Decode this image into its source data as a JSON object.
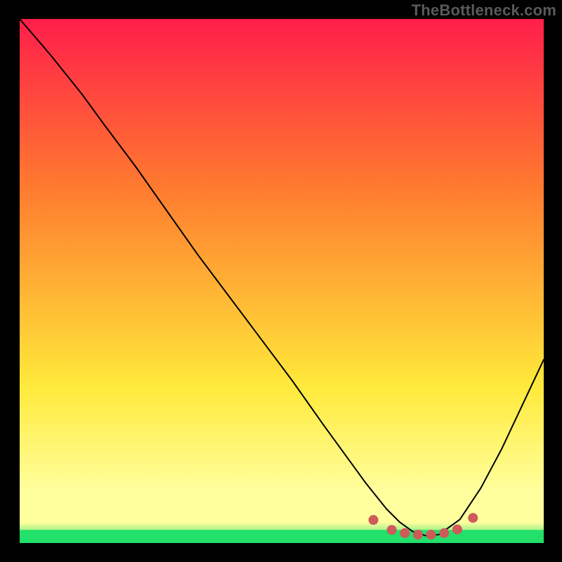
{
  "watermark": "TheBottleneck.com",
  "chart_data": {
    "type": "line",
    "title": "",
    "xlabel": "",
    "ylabel": "",
    "xlim": [
      0,
      100
    ],
    "ylim": [
      0,
      100
    ],
    "grid": false,
    "legend": false,
    "background_gradient": {
      "top": "#ff1e4a",
      "mid1": "#ff7a2f",
      "mid2": "#ffe93a",
      "band": "#ffff9d",
      "bottom": "#22e06a"
    },
    "series": [
      {
        "name": "bottleneck-curve",
        "color": "#000000",
        "width": 2,
        "x": [
          0,
          6,
          12,
          16,
          22,
          28,
          34,
          40,
          46,
          52,
          58,
          62,
          66,
          70,
          72.5,
          75,
          77.5,
          80,
          84,
          88,
          92,
          96,
          100
        ],
        "y": [
          100,
          93,
          85.5,
          80,
          72,
          63.5,
          55,
          47,
          39,
          31,
          22.5,
          17,
          11.5,
          6.5,
          4,
          2.2,
          1.4,
          1.6,
          4.5,
          10.5,
          18,
          26.5,
          35
        ]
      }
    ],
    "markers": {
      "name": "trough-markers",
      "color": "#cf5a5a",
      "radius": 7,
      "points": [
        {
          "x": 67.5,
          "y": 4.4
        },
        {
          "x": 71.0,
          "y": 2.5
        },
        {
          "x": 73.5,
          "y": 1.9
        },
        {
          "x": 76.0,
          "y": 1.6
        },
        {
          "x": 78.5,
          "y": 1.6
        },
        {
          "x": 81.0,
          "y": 1.9
        },
        {
          "x": 83.5,
          "y": 2.6
        },
        {
          "x": 86.5,
          "y": 4.8
        }
      ]
    }
  }
}
